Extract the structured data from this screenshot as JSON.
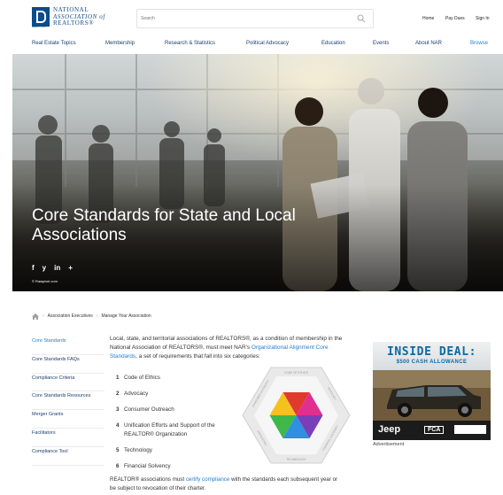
{
  "header": {
    "logo_lines": [
      "NATIONAL",
      "ASSOCIATION of",
      "REALTORS®"
    ],
    "logo_sub": "REALTOR®",
    "search_placeholder": "Search",
    "home": "Home",
    "pay_dues": "Pay Dues",
    "sign_in": "Sign In"
  },
  "nav": [
    "Real Estate Topics",
    "Membership",
    "Research & Statistics",
    "Political Advocacy",
    "Education",
    "Events",
    "About NAR",
    "Browse"
  ],
  "hero": {
    "title": "Core Standards for State and Local Associations",
    "social": [
      "f",
      "y",
      "in",
      "+"
    ],
    "credit": "© Rawpixel.com"
  },
  "breadcrumb": {
    "icon": "home-icon",
    "items": [
      "Association Executives",
      "Manage Your Association"
    ]
  },
  "sidebar": [
    "Core Standards",
    "Core Standards FAQs",
    "Compliance Criteria",
    "Core Standards Resources",
    "Merger Grants",
    "Facilitators",
    "Compliance Tool"
  ],
  "content": {
    "intro_before": "Local, state, and territorial associations of REALTORS®, as a condition of membership in the National Association of REALTORS®, must meet NAR's ",
    "intro_link": "Organizational Alignment Core Standards",
    "intro_after": ", a set of requirements that fall into six categories:",
    "categories": [
      {
        "num": "1",
        "label": "Code of Ethics"
      },
      {
        "num": "2",
        "label": "Advocacy"
      },
      {
        "num": "3",
        "label": "Consumer Outreach"
      },
      {
        "num": "4",
        "label": "Unification Efforts and Support of the"
      },
      {
        "num": "",
        "label": "REALTOR® Organization"
      },
      {
        "num": "5",
        "label": "Technology"
      },
      {
        "num": "6",
        "label": "Financial Solvency"
      }
    ],
    "wheel_labels": [
      "CODE OF ETHICS",
      "ADVOCACY",
      "CONSUMER OUTREACH",
      "UNIFICATION",
      "TECHNOLOGY",
      "FINANCIAL SOLVENCY"
    ],
    "footer_before": "REALTOR® associations must ",
    "footer_link": "certify compliance",
    "footer_after": " with the standards each subsequent year or be subject to revocation of their charter."
  },
  "ad": {
    "title": "INSIDE DEAL:",
    "subtitle": "$500 CASH ALLOWANCE",
    "brand": "Jeep",
    "logo": "FCA",
    "caption": "Advertisement"
  },
  "colors": {
    "brand_blue": "#0c4b8c",
    "link_blue": "#1e7fd2",
    "nav_text": "#1a3f6e"
  }
}
